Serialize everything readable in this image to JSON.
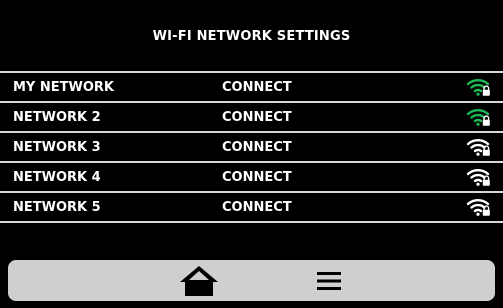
{
  "title": "WI-FI NETWORK SETTINGS",
  "networks": [
    {
      "name": "MY NETWORK",
      "action": "CONNECT",
      "icon": "wifi-lock-icon",
      "color": "#1db954"
    },
    {
      "name": "NETWORK 2",
      "action": "CONNECT",
      "icon": "wifi-lock-icon",
      "color": "#1db954"
    },
    {
      "name": "NETWORK 3",
      "action": "CONNECT",
      "icon": "wifi-lock-icon",
      "color": "#ffffff"
    },
    {
      "name": "NETWORK 4",
      "action": "CONNECT",
      "icon": "wifi-lock-icon",
      "color": "#ffffff"
    },
    {
      "name": "NETWORK 5",
      "action": "CONNECT",
      "icon": "wifi-lock-icon",
      "color": "#ffffff"
    }
  ],
  "footer": {
    "home_icon": "home-icon",
    "menu_icon": "menu-icon",
    "bar_color": "#cfcfcf"
  }
}
